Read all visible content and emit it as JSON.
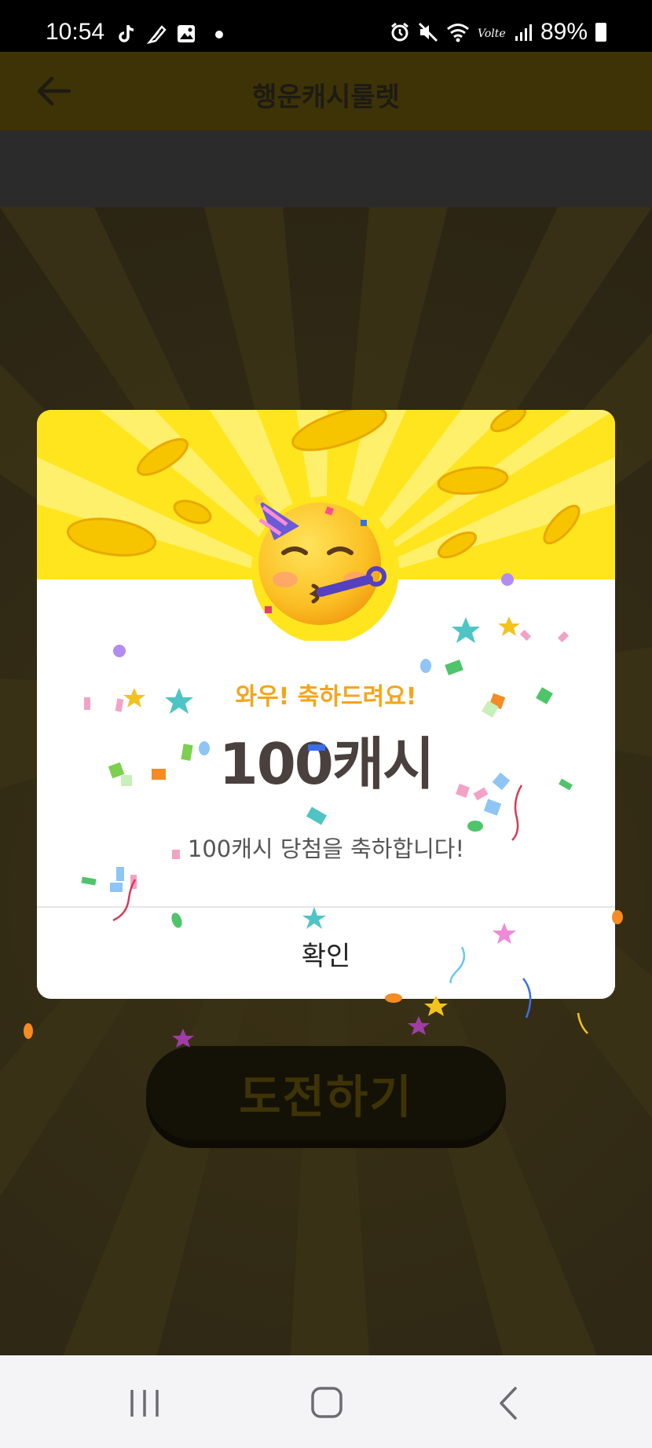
{
  "status_bar": {
    "time": "10:54",
    "battery": "89%",
    "icons_left": [
      "tiktok-icon",
      "feather-icon",
      "gallery-icon",
      "dot"
    ],
    "icons_right": [
      "alarm-icon",
      "mute-icon",
      "wifi-icon",
      "volte-icon",
      "signal-icon",
      "battery-icon"
    ]
  },
  "app_bar": {
    "title": "행운캐시룰렛",
    "back_icon": "arrow-left-icon"
  },
  "background": {
    "challenge_button": "도전하기"
  },
  "dialog": {
    "subtitle": "와우! 축하드려요!",
    "amount": "100캐시",
    "message": "100캐시 당첨을 축하합니다!",
    "confirm": "확인",
    "emoji": "partying-face-emoji"
  },
  "colors": {
    "banner_yellow": "#ffe51e",
    "subtitle_orange": "#f4a51c",
    "amount_text": "#4a403d"
  },
  "nav_bar": {
    "buttons": [
      "recent-apps-icon",
      "home-icon",
      "back-icon"
    ]
  }
}
